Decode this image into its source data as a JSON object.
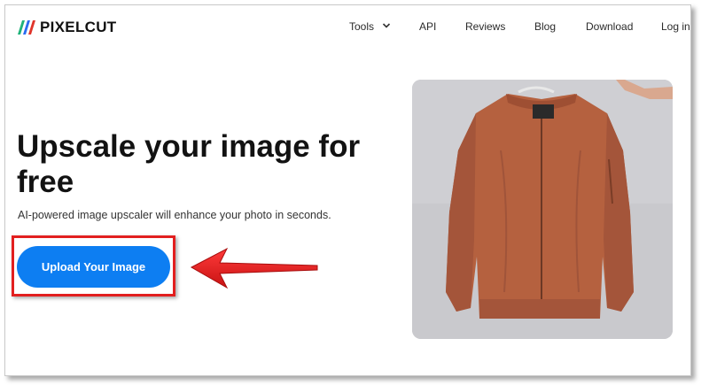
{
  "brand": {
    "name": "PIXELCUT",
    "logo_colors": [
      "#1fb37a",
      "#2a6cf0",
      "#e0352b"
    ]
  },
  "nav": {
    "tools": "Tools",
    "api": "API",
    "reviews": "Reviews",
    "blog": "Blog",
    "download": "Download",
    "login": "Log in"
  },
  "hero": {
    "title": "Upscale your image for free",
    "subtitle": "AI-powered image upscaler will enhance your photo in seconds.",
    "cta_label": "Upload Your Image"
  },
  "annotation": {
    "highlight_color": "#e21f1f",
    "arrow_color": "#e21f1f",
    "arrow_direction": "left"
  },
  "colors": {
    "cta_background": "#0d7ef2",
    "jacket": "#b5613f",
    "image_background": "#c8c8cc"
  },
  "icons": {
    "tools_menu": "chevron-down-icon",
    "annotation": "arrow-left-icon"
  }
}
